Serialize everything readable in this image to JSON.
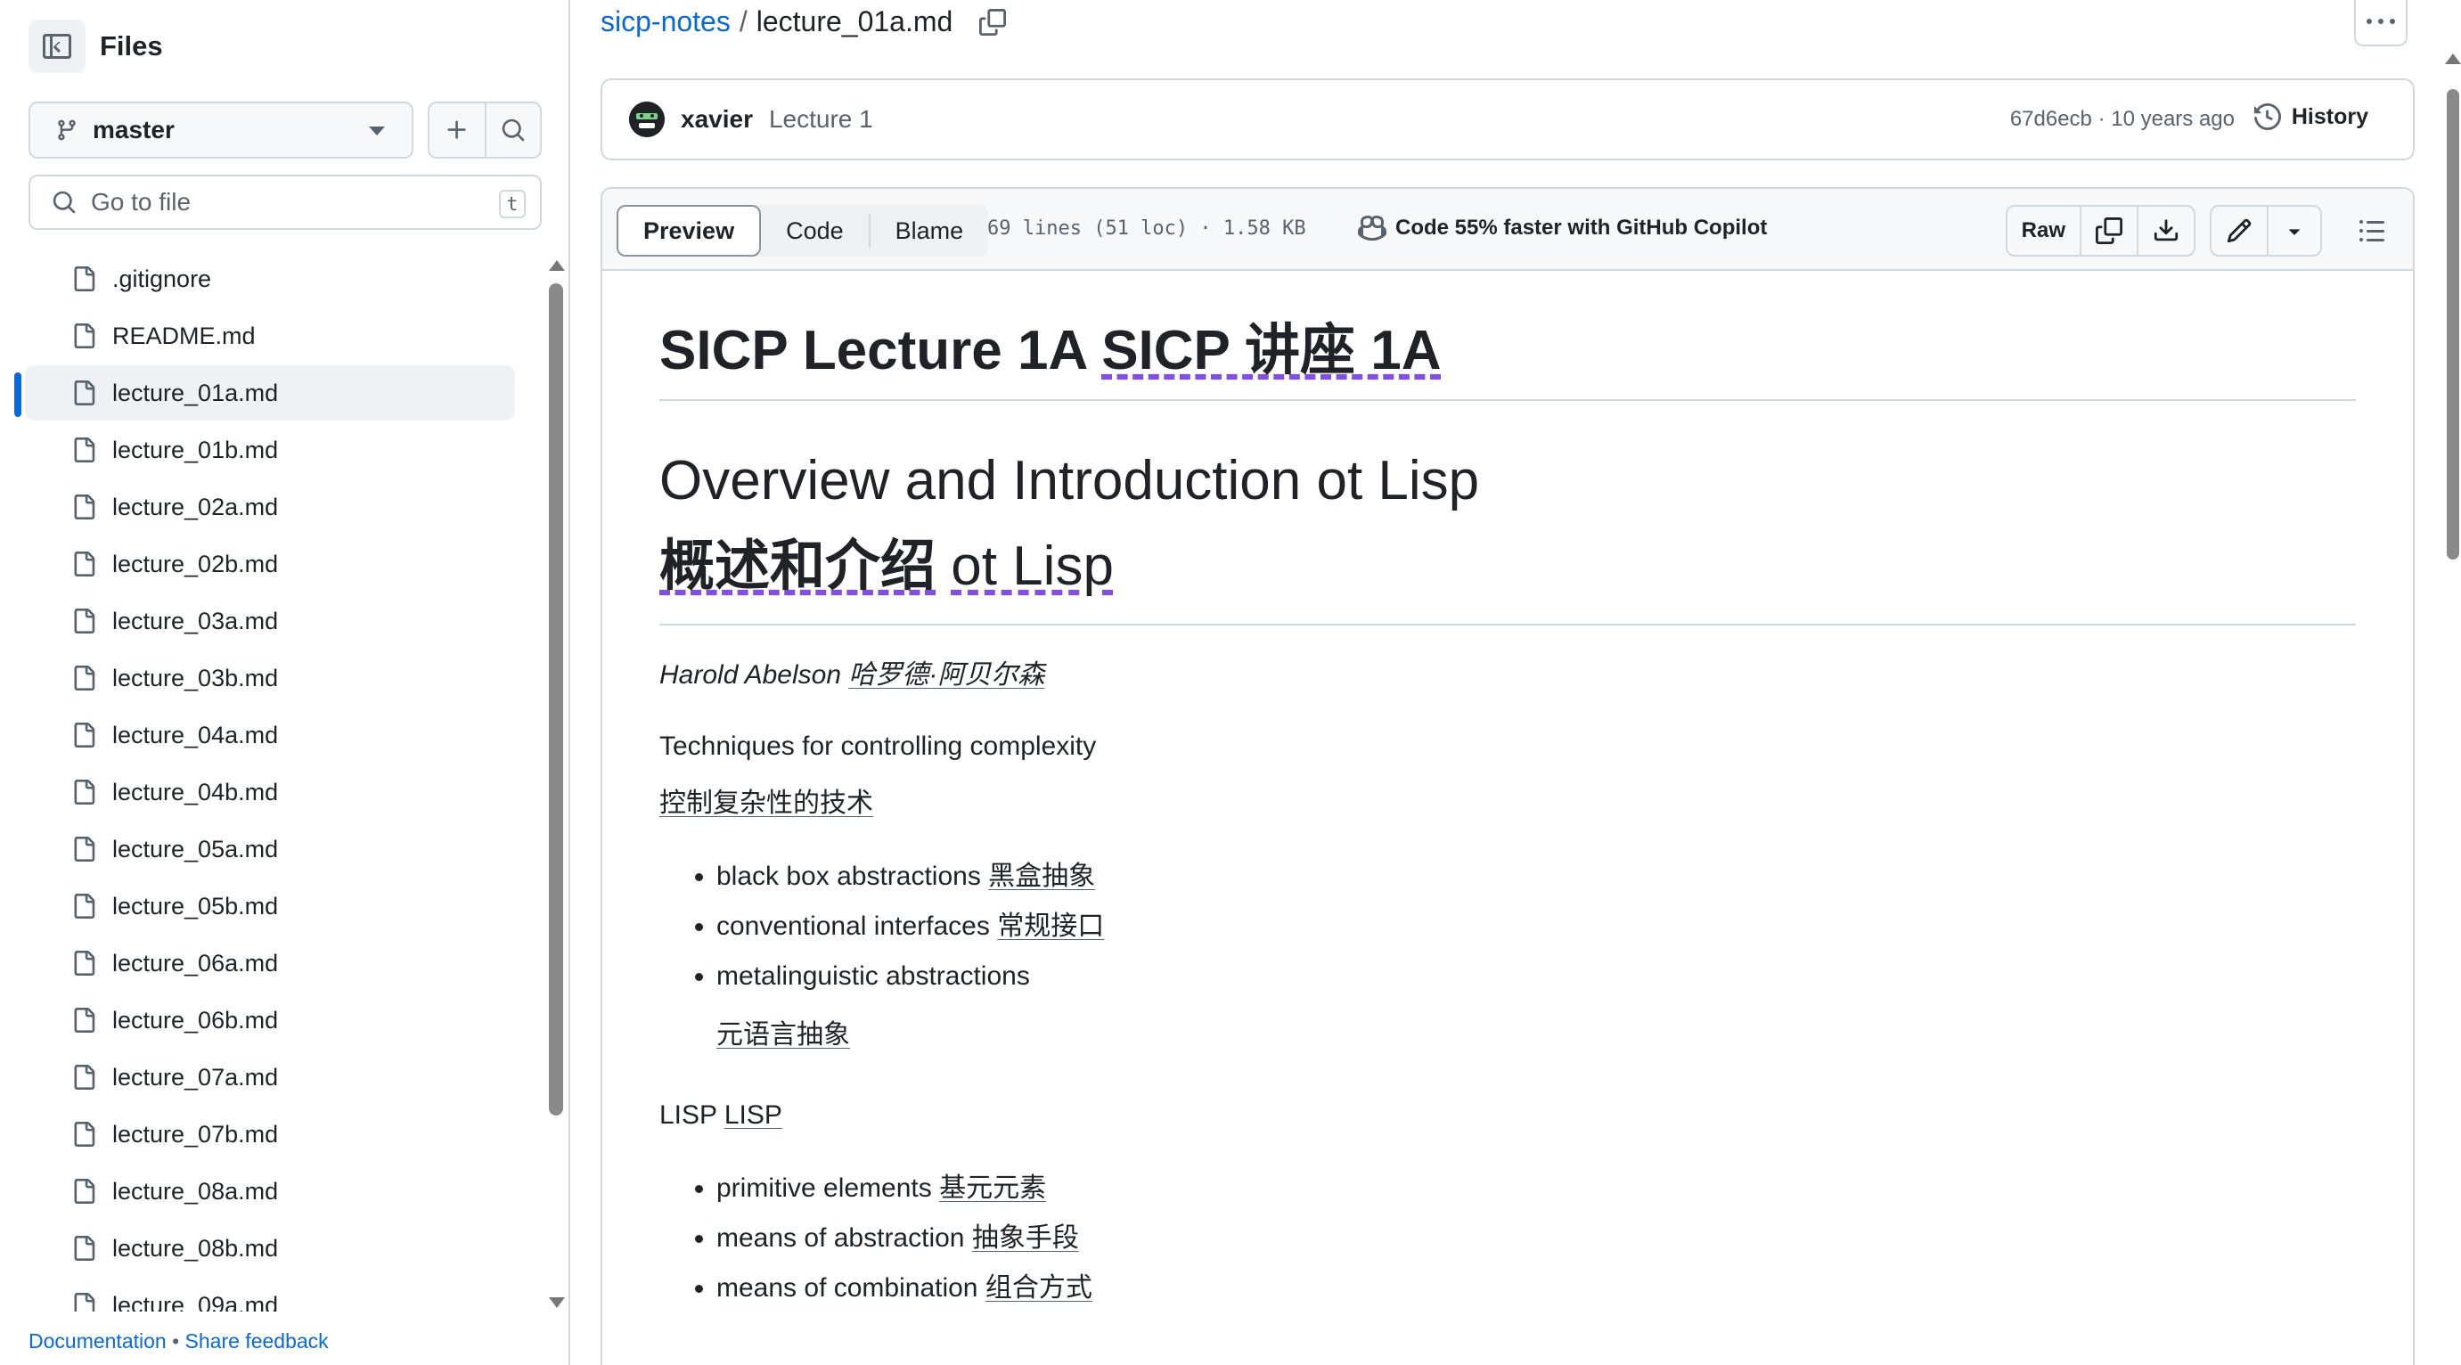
{
  "sidebar": {
    "title": "Files",
    "branch": "master",
    "search_placeholder": "Go to file",
    "search_shortcut": "t",
    "files": [
      ".gitignore",
      "README.md",
      "lecture_01a.md",
      "lecture_01b.md",
      "lecture_02a.md",
      "lecture_02b.md",
      "lecture_03a.md",
      "lecture_03b.md",
      "lecture_04a.md",
      "lecture_04b.md",
      "lecture_05a.md",
      "lecture_05b.md",
      "lecture_06a.md",
      "lecture_06b.md",
      "lecture_07a.md",
      "lecture_07b.md",
      "lecture_08a.md",
      "lecture_08b.md",
      "lecture_09a.md"
    ],
    "active_file": "lecture_01a.md",
    "footer": {
      "docs": "Documentation",
      "sep": "•",
      "feedback": "Share feedback"
    }
  },
  "breadcrumb": {
    "repo": "sicp-notes",
    "sep": "/",
    "file": "lecture_01a.md"
  },
  "commit": {
    "author": "xavier",
    "message": "Lecture 1",
    "meta": "67d6ecb · 10 years ago",
    "history_label": "History"
  },
  "toolbar": {
    "tabs": [
      "Preview",
      "Code",
      "Blame"
    ],
    "active_tab": "Preview",
    "file_info": "69 lines (51 loc) · 1.58 KB",
    "copilot": "Code 55% faster with GitHub Copilot",
    "raw_label": "Raw"
  },
  "content": {
    "h1_en": "SICP Lecture 1A",
    "h1_zh": "SICP 讲座 1A",
    "h2_en": "Overview and Introduction ot Lisp",
    "h2_zh": "概述和介绍",
    "h2_zh_tail": "ot Lisp",
    "author_en": "Harold Abelson",
    "author_zh": "哈罗德·阿贝尔森",
    "techniques_en": "Techniques for controlling complexity",
    "techniques_zh": "控制复杂性的技术",
    "list1": [
      {
        "en": "black box abstractions",
        "zh": "黑盒抽象"
      },
      {
        "en": "conventional interfaces",
        "zh": "常规接口"
      },
      {
        "en": "metalinguistic abstractions",
        "zh": "元语言抽象"
      }
    ],
    "lisp_en": "LISP",
    "lisp_zh": "LISP",
    "list2": [
      {
        "en": "primitive elements",
        "zh": "基元元素"
      },
      {
        "en": "means of abstraction",
        "zh": "抽象手段"
      },
      {
        "en": "means of combination",
        "zh": "组合方式"
      }
    ]
  },
  "colors": {
    "link": "#0969da",
    "border": "#d1d9e0",
    "text": "#1f2328",
    "muted": "#59636e"
  }
}
